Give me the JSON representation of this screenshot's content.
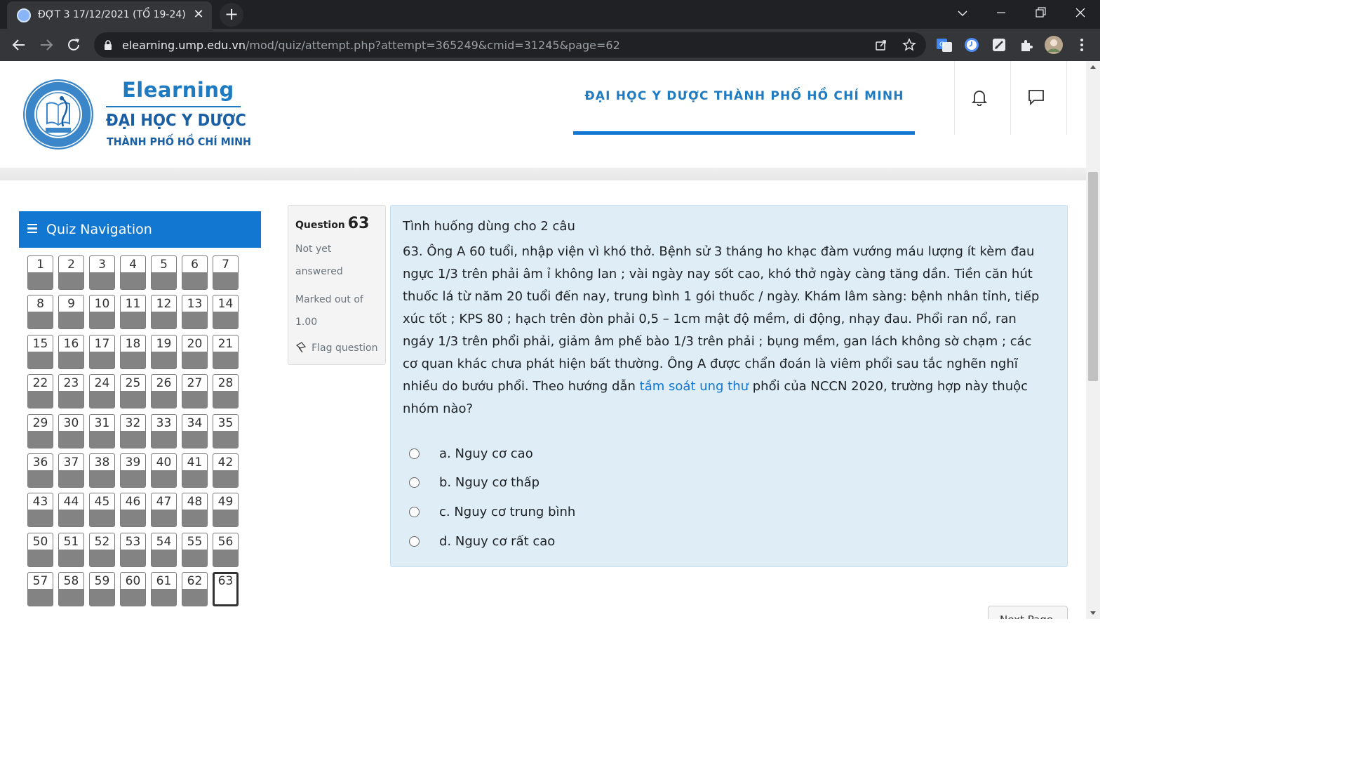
{
  "browser": {
    "tab_title": "ĐỢT 3 17/12/2021 (TỔ 19-24)",
    "url_host": "elearning.ump.edu.vn",
    "url_path": "/mod/quiz/attempt.php?attempt=365249&cmid=31245&page=62"
  },
  "header": {
    "brand_elearning": "Elearning",
    "brand_line1": "ĐẠI HỌC Y DƯỢC",
    "brand_line2": "THÀNH PHỐ HỒ CHÍ MINH",
    "university_title": "ĐẠI HỌC Y DƯỢC THÀNH PHỐ HỒ CHÍ MINH"
  },
  "quiz_nav": {
    "title": "Quiz Navigation",
    "current": "63",
    "buttons": [
      "1",
      "2",
      "3",
      "4",
      "5",
      "6",
      "7",
      "8",
      "9",
      "10",
      "11",
      "12",
      "13",
      "14",
      "15",
      "16",
      "17",
      "18",
      "19",
      "20",
      "21",
      "22",
      "23",
      "24",
      "25",
      "26",
      "27",
      "28",
      "29",
      "30",
      "31",
      "32",
      "33",
      "34",
      "35",
      "36",
      "37",
      "38",
      "39",
      "40",
      "41",
      "42",
      "43",
      "44",
      "45",
      "46",
      "47",
      "48",
      "49",
      "50",
      "51",
      "52",
      "53",
      "54",
      "55",
      "56",
      "57",
      "58",
      "59",
      "60",
      "61",
      "62",
      "63"
    ]
  },
  "question": {
    "label": "Question",
    "number": "63",
    "state": "Not yet answered",
    "grade": "Marked out of 1.00",
    "flag_label": "Flag question",
    "intro": "Tình huống dùng cho 2 câu",
    "text_before_link": "63. Ông A 60 tuổi, nhập viện vì khó thở. Bệnh sử 3 tháng ho khạc đàm vướng máu lượng ít kèm đau ngực 1/3 trên phải âm ỉ không lan ; vài ngày nay sốt cao, khó thở ngày càng tăng dần. Tiền căn hút thuốc lá từ năm 20 tuổi đến nay, trung bình 1 gói thuốc / ngày. Khám lâm sàng: bệnh nhân tỉnh, tiếp xúc tốt ; KPS 80 ; hạch trên đòn phải 0,5 – 1cm mật độ mềm, di động, nhạy đau. Phổi ran nổ, ran ngáy 1/3 trên phổi phải, giảm âm phế bào 1/3 trên phải ; bụng mềm, gan lách không sờ chạm ; các cơ quan khác chưa phát hiện bất thường. Ông A được chẩn đoán là viêm phổi sau tắc nghẽn nghĩ nhiều do bướu phổi. Theo hướng dẫn ",
    "link_text": "tầm soát ung thư",
    "text_after_link": " phổi của NCCN 2020, trường hợp này thuộc nhóm nào?",
    "answers": [
      "a. Nguy cơ cao",
      "b. Nguy cơ thấp",
      "c. Nguy cơ trung bình",
      "d. Nguy cơ rất cao"
    ]
  },
  "next_page_label": "Next Page"
}
